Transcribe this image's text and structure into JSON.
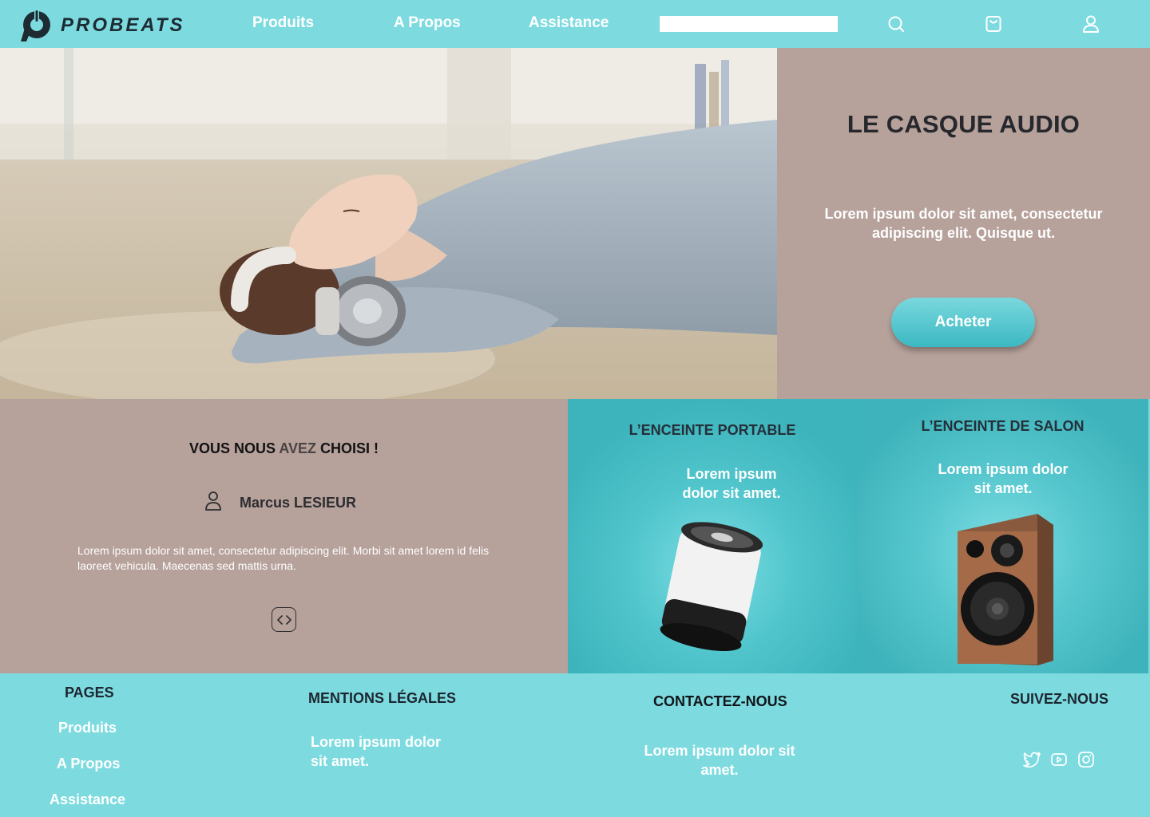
{
  "brand": {
    "name": "PROBEATS",
    "logo_icon": "probeats-logo-icon"
  },
  "nav": {
    "items": [
      {
        "label": "Produits"
      },
      {
        "label": "A Propos"
      },
      {
        "label": "Assistance"
      }
    ],
    "search": {
      "value": "",
      "placeholder": ""
    },
    "icons": [
      "search-icon",
      "shopping-bag-icon",
      "user-icon"
    ]
  },
  "hero": {
    "image": "woman-lying-with-headphones-photo",
    "title": "LE CASQUE AUDIO",
    "text": "Lorem ipsum dolor sit amet, consectetur adipiscing elit. Quisque ut.",
    "button_label": "Acheter"
  },
  "testimonial": {
    "title_start": "VOUS NOUS ",
    "title_accent": "AVEZ",
    "title_end": " CHOISI !",
    "author": "Marcus LESIEUR",
    "text": "Lorem ipsum dolor sit amet, consectetur adipiscing elit. Morbi sit amet lorem id felis laoreet vehicula. Maecenas sed mattis urna.",
    "control_icon": "code-brackets-icon"
  },
  "products": [
    {
      "title": "L’ENCEINTE PORTABLE",
      "text_line1": "Lorem ipsum",
      "text_line2": "dolor sit amet.",
      "image": "portable-speaker-image"
    },
    {
      "title": "L’ENCEINTE DE SALON",
      "text_line1": "Lorem ipsum dolor",
      "text_line2": "sit amet.",
      "image": "bookshelf-speaker-image"
    }
  ],
  "footer": {
    "pages": {
      "title": "PAGES",
      "links": [
        "Produits",
        "A Propos",
        "Assistance"
      ]
    },
    "legal": {
      "title": "MENTIONS LÉGALES",
      "text_line1": "Lorem ipsum dolor",
      "text_line2": "sit amet."
    },
    "contact": {
      "title": "CONTACTEZ-NOUS",
      "text_line1": "Lorem ipsum dolor sit",
      "text_line2": "amet."
    },
    "follow": {
      "title": "SUIVEZ-NOUS",
      "icons": [
        "twitter-icon",
        "youtube-icon",
        "instagram-icon"
      ]
    }
  },
  "colors": {
    "header_bg": "#7ddbe0",
    "panel_taupe": "#b6a19b",
    "card_teal": "#3db3bb",
    "button_teal": "#3cb8c2",
    "dark_text": "#26282d",
    "white": "#ffffff"
  }
}
